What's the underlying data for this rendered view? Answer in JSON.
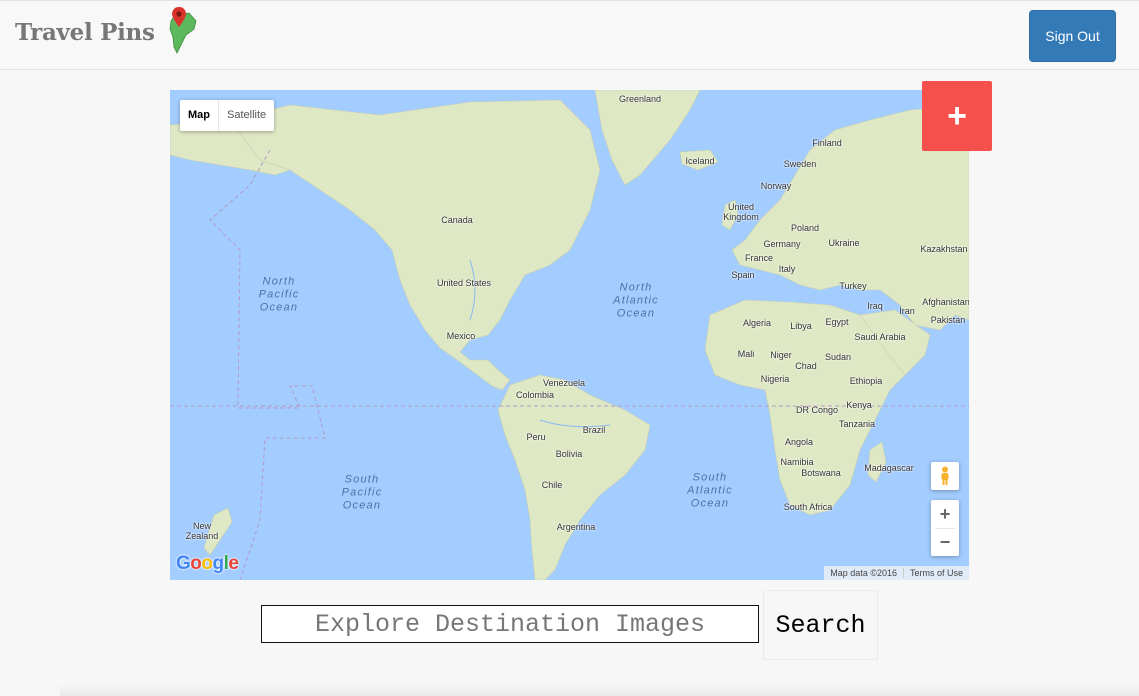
{
  "header": {
    "brand": "Travel Pins",
    "sign_out_label": "Sign Out"
  },
  "map": {
    "type_controls": {
      "map": "Map",
      "satellite": "Satellite"
    },
    "zoom_in": "+",
    "zoom_out": "−",
    "google_logo": "Google",
    "attribution": "Map data ©2016",
    "terms": "Terms of Use",
    "ocean_labels": {
      "north_pacific": "North\nPacific\nOcean",
      "north_atlantic": "North\nAtlantic\nOcean",
      "south_pacific": "South\nPacific\nOcean",
      "south_atlantic": "South\nAtlantic\nOcean"
    },
    "place_labels": {
      "greenland": "Greenland",
      "iceland": "Iceland",
      "finland": "Finland",
      "sweden": "Sweden",
      "norway": "Norway",
      "united_kingdom": "United\nKingdom",
      "poland": "Poland",
      "germany": "Germany",
      "ukraine": "Ukraine",
      "kazakhstan": "Kazakhstan",
      "france": "France",
      "spain": "Spain",
      "italy": "Italy",
      "turkey": "Turkey",
      "iraq": "Iraq",
      "iran": "Iran",
      "afghanistan": "Afghanistan",
      "pakistan": "Pakistan",
      "canada": "Canada",
      "united_states": "United States",
      "mexico": "Mexico",
      "venezuela": "Venezuela",
      "colombia": "Colombia",
      "peru": "Peru",
      "brazil": "Brazil",
      "bolivia": "Bolivia",
      "chile": "Chile",
      "argentina": "Argentina",
      "algeria": "Algeria",
      "libya": "Libya",
      "egypt": "Egypt",
      "saudi_arabia": "Saudi Arabia",
      "mali": "Mali",
      "niger": "Niger",
      "chad": "Chad",
      "sudan": "Sudan",
      "nigeria": "Nigeria",
      "ethiopia": "Ethiopia",
      "dr_congo": "DR Congo",
      "kenya": "Kenya",
      "tanzania": "Tanzania",
      "angola": "Angola",
      "namibia": "Namibia",
      "botswana": "Botswana",
      "madagascar": "Madagascar",
      "south_africa": "South Africa",
      "new_zealand": "New\nZealand"
    }
  },
  "add_button_label": "+",
  "search": {
    "placeholder": "Explore Destination Images",
    "button_label": "Search"
  },
  "colors": {
    "ocean": "#a3ccff",
    "land": "#dfe8c4",
    "add_button": "#f5504c",
    "sign_out": "#337ab7"
  }
}
